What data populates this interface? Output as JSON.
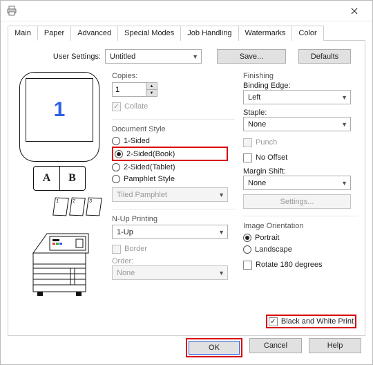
{
  "window": {
    "preview_number": "1"
  },
  "tabs": [
    "Main",
    "Paper",
    "Advanced",
    "Special Modes",
    "Job Handling",
    "Watermarks",
    "Color"
  ],
  "active_tab": "Main",
  "user_settings": {
    "label": "User Settings:",
    "value": "Untitled",
    "save": "Save...",
    "defaults": "Defaults"
  },
  "copies": {
    "label": "Copies:",
    "value": "1",
    "collate": "Collate"
  },
  "doc_style": {
    "label": "Document Style",
    "one_sided": "1-Sided",
    "two_sided_book": "2-Sided(Book)",
    "two_sided_tablet": "2-Sided(Tablet)",
    "pamphlet": "Pamphlet Style",
    "tiled": "Tiled Pamphlet"
  },
  "nup": {
    "label": "N-Up Printing",
    "value": "1-Up",
    "border": "Border",
    "order": "Order:",
    "order_value": "None"
  },
  "finishing": {
    "label": "Finishing",
    "binding_label": "Binding Edge:",
    "binding_value": "Left",
    "staple_label": "Staple:",
    "staple_value": "None",
    "punch": "Punch",
    "nooffset": "No Offset",
    "margin_shift_label": "Margin Shift:",
    "margin_shift_value": "None",
    "settings": "Settings..."
  },
  "orientation": {
    "label": "Image Orientation",
    "portrait": "Portrait",
    "landscape": "Landscape",
    "rotate": "Rotate 180 degrees"
  },
  "bw": "Black and White Print",
  "footer": {
    "ok": "OK",
    "cancel": "Cancel",
    "help": "Help"
  },
  "book": {
    "left": "A",
    "right": "B"
  }
}
